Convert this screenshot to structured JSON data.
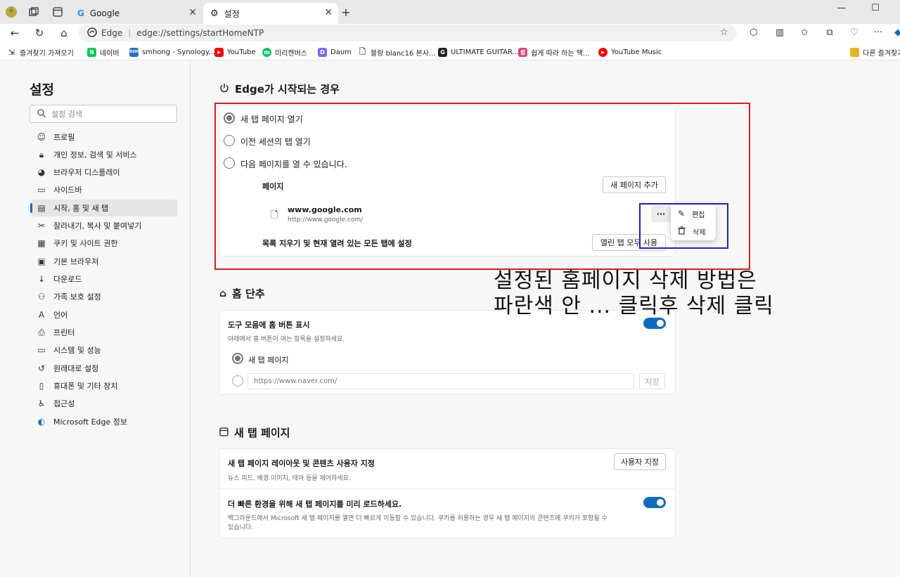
{
  "tabs": [
    {
      "label": "Google",
      "icon": "google-g-icon"
    },
    {
      "label": "설정",
      "icon": "gear-icon"
    }
  ],
  "address": {
    "site_label": "Edge",
    "url": "edge://settings/startHomeNTP"
  },
  "bookmarks": [
    {
      "label": "즐겨찾기 가져오기",
      "color": "#555555"
    },
    {
      "label": "네이버",
      "color": "#03c75a"
    },
    {
      "label": "smhong - Synology...",
      "color": "#2b6ebf"
    },
    {
      "label": "YouTube",
      "color": "#ff0000"
    },
    {
      "label": "미리캔버스",
      "color": "#11c26d"
    },
    {
      "label": "Daum",
      "color": "#7a6cf0"
    },
    {
      "label": "블랑 blanc16 본사...",
      "color": "#888888"
    },
    {
      "label": "ULTIMATE GUITAR...",
      "color": "#222222"
    },
    {
      "label": "쉽게 따라 하는 맥...",
      "color": "#d9467a"
    },
    {
      "label": "YouTube Music",
      "color": "#ff0000"
    },
    {
      "label": "다른 즐겨찾기",
      "color": "#e6b422"
    }
  ],
  "sidebar": {
    "title": "설정",
    "search_placeholder": "설정 검색",
    "items": [
      {
        "label": "프로필",
        "icon": "profile-icon"
      },
      {
        "label": "개인 정보, 검색 및 서비스",
        "icon": "lock-icon"
      },
      {
        "label": "브라우저 디스플레이",
        "icon": "palette-icon"
      },
      {
        "label": "사이드바",
        "icon": "sidebar-icon"
      },
      {
        "label": "시작, 홈 및 새 탭",
        "icon": "home-tab-icon"
      },
      {
        "label": "잘라내기, 복사 및 붙여넣기",
        "icon": "clipboard-icon"
      },
      {
        "label": "쿠키 및 사이트 권한",
        "icon": "cookie-icon"
      },
      {
        "label": "기본 브라우저",
        "icon": "browser-icon"
      },
      {
        "label": "다운로드",
        "icon": "download-icon"
      },
      {
        "label": "가족 보호 설정",
        "icon": "family-icon"
      },
      {
        "label": "언어",
        "icon": "language-icon"
      },
      {
        "label": "프린터",
        "icon": "printer-icon"
      },
      {
        "label": "시스템 및 성능",
        "icon": "laptop-icon"
      },
      {
        "label": "원래대로 설정",
        "icon": "reset-icon"
      },
      {
        "label": "휴대폰 및 기타 장치",
        "icon": "phone-icon"
      },
      {
        "label": "접근성",
        "icon": "accessibility-icon"
      },
      {
        "label": "Microsoft Edge 정보",
        "icon": "edge-logo-icon"
      }
    ],
    "selected_index": 4
  },
  "startup": {
    "title": "Edge가 시작되는 경우",
    "options": [
      "새 탭 페이지 열기",
      "이전 세션의 탭 열기",
      "다음 페이지를 열 수 있습니다."
    ],
    "selected_option": 0,
    "pages_label": "페이지",
    "add_page_button": "새 페이지 추가",
    "page_title": "www.google.com",
    "page_url": "http://www.google.com/",
    "more_button": "···",
    "clear_label": "목록 지우기 및 현재 열려 있는 모든 탭에 설정",
    "use_open_tabs_button": "열린 탭 모두 사용",
    "menu": {
      "edit": "편집",
      "delete": "삭제"
    }
  },
  "home": {
    "title": "홈 단추",
    "show_label": "도구 모음에 홈 버튼 표시",
    "show_desc": "아래에서 홈 버튼이 여는 항목을 설정하세요.",
    "option_new_tab": "새 탭 페이지",
    "url_placeholder": "https://www.naver.com/",
    "save_button": "저장",
    "toggle_on": true
  },
  "newtab": {
    "title": "새 탭 페이지",
    "customize_label": "새 탭 페이지 레이아웃 및 콘텐츠 사용자 지정",
    "customize_desc": "뉴스 피드, 배경 이미지, 테마 등을 제어하세요.",
    "customize_button": "사용자 지정",
    "preload_label": "더 빠른 환경을 위해 새 탭 페이지를 미리 로드하세요.",
    "preload_desc_1": "백그라운드에서 Microsoft 새 탭 페이지를 열면 더 빠르게 이동할 수 있습니다. 쿠키를 허용하는 경우 새 탭 페이지의 콘텐츠에 쿠키가 포함될 수",
    "preload_desc_2": "있습니다.",
    "toggle_on": true
  },
  "annotation": {
    "line1": "설정된 홈페이지 삭제 방법은",
    "line2": "파란색 안 ... 클릭후 삭제 클릭"
  }
}
